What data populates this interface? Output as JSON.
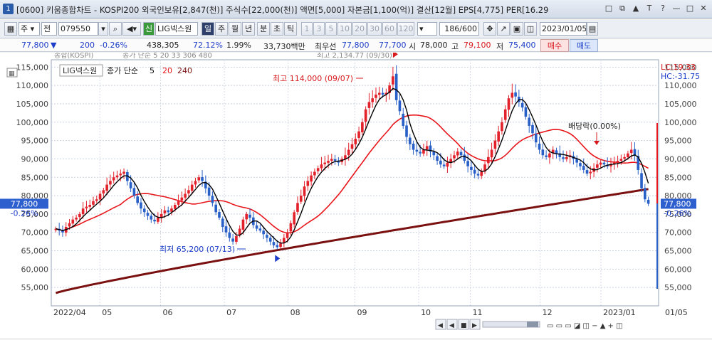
{
  "window": {
    "app_icon": "1",
    "title": "[0600] 키움종합차트 - KOSPI200 외국인보유[2,847(천)] 주식수[22,000(천)] 액면[5,000] 자본금[1,100(억)] 결산[12월] EPS[4,775] PER[16.29",
    "buttons": [
      "□",
      "⧉",
      "▲",
      "T",
      "?",
      "—",
      "□",
      "✕"
    ]
  },
  "toolbar": {
    "market_select": "주",
    "prev_label": "전",
    "code": "079550",
    "search_icon": "magnifier-icon",
    "name_tag": "신",
    "stock_name": "LIG넥스원",
    "period_buttons": [
      "일",
      "주",
      "월",
      "년",
      "분",
      "초",
      "틱"
    ],
    "active_period": "일",
    "interval_buttons": [
      "1",
      "3",
      "5",
      "10",
      "20",
      "30",
      "60",
      "120"
    ],
    "count": "186/600",
    "date": "2023/01/05"
  },
  "quote": {
    "price": "77,800",
    "arrow": "▼",
    "change": "200",
    "change_pct": "-0.26%",
    "volume": "438,305",
    "ratio": "72.12%",
    "turnover": "1.99%",
    "amount": "33,730백만",
    "best_label": "최우선",
    "best_ask": "77,800",
    "best_bid": "77,700",
    "open_label": "시",
    "open": "78,000",
    "high_label": "고",
    "high": "79,100",
    "low_label": "저",
    "low": "75,400",
    "buy_label": "매수",
    "sell_label": "매도"
  },
  "chart": {
    "header_index": "종합(KOSPI)",
    "header_ma": "종가 단순 5  20  33  306  480",
    "header_high": "최고 2,134.77 (09/30)",
    "legend_name": "LIG넥스원",
    "legend_ma_label": "종가 단순",
    "legend_ma_periods": [
      "5",
      "20",
      "240"
    ],
    "lc_label": "LC:19.33",
    "hc_label": "HC:-31.75",
    "current_price_tag": "77,800",
    "current_pct_tag": "-0.26%",
    "high_annotation": "최고 114,000 (09/07)",
    "low_annotation": "최저 65,200 (07/13)",
    "dividend_annotation": "배당락(0.00%)",
    "y_labels": [
      "115,000",
      "110,000",
      "105,000",
      "100,000",
      "95,000",
      "90,000",
      "85,000",
      "80,000",
      "75,000",
      "70,000",
      "65,000",
      "60,000",
      "55,000"
    ],
    "x_labels": [
      "2022/04",
      "05",
      "06",
      "07",
      "08",
      "09",
      "10",
      "11",
      "12",
      "2023/01",
      "01/05"
    ],
    "colors": {
      "up": "#e2212b",
      "down": "#2860c8",
      "ma5": "#000000",
      "ma20": "#e8161b",
      "ma240": "#7a1010"
    }
  },
  "chart_data": {
    "type": "candlestick",
    "ylim": [
      50000,
      117000
    ],
    "ma_periods": [
      5,
      20,
      240
    ],
    "candles_close": [
      71000,
      70500,
      70000,
      71500,
      72500,
      73500,
      74000,
      75000,
      76500,
      77000,
      77500,
      78500,
      79000,
      80500,
      81500,
      83000,
      84000,
      85000,
      85500,
      86000,
      86500,
      84000,
      82000,
      80000,
      78000,
      76500,
      75500,
      74500,
      73500,
      73000,
      74000,
      75000,
      76000,
      75500,
      76500,
      77500,
      78500,
      79500,
      80500,
      81500,
      83000,
      84000,
      85000,
      84000,
      82000,
      80000,
      78000,
      75500,
      74000,
      71500,
      70000,
      68500,
      67500,
      69000,
      71000,
      73500,
      75000,
      74000,
      72000,
      71000,
      70500,
      69500,
      68500,
      67500,
      66500,
      66000,
      67000,
      68500,
      70000,
      72500,
      75500,
      78000,
      80000,
      82500,
      84000,
      85500,
      86500,
      87500,
      88500,
      89000,
      89500,
      90000,
      89500,
      89000,
      90000,
      91000,
      92500,
      94000,
      95500,
      97500,
      100000,
      103500,
      105500,
      106500,
      107500,
      108000,
      107500,
      108000,
      110000,
      112500,
      106000,
      103000,
      99000,
      96000,
      94000,
      92500,
      92000,
      91500,
      92500,
      93500,
      92000,
      91000,
      89500,
      88500,
      88000,
      89000,
      90000,
      91000,
      92000,
      91000,
      89500,
      88000,
      87000,
      86000,
      85500,
      86500,
      88500,
      90500,
      92500,
      95000,
      97500,
      100000,
      103500,
      106500,
      108000,
      107000,
      105500,
      104000,
      101500,
      99000,
      97000,
      94500,
      92500,
      91000,
      90500,
      91500,
      92500,
      91500,
      90500,
      90000,
      90500,
      91000,
      90000,
      89000,
      88000,
      87000,
      86000,
      86500,
      87500,
      88500,
      89000,
      88500,
      88000,
      88500,
      89000,
      89500,
      90000,
      90500,
      91500,
      92500,
      91000,
      87000,
      82000,
      79000,
      77800
    ]
  }
}
